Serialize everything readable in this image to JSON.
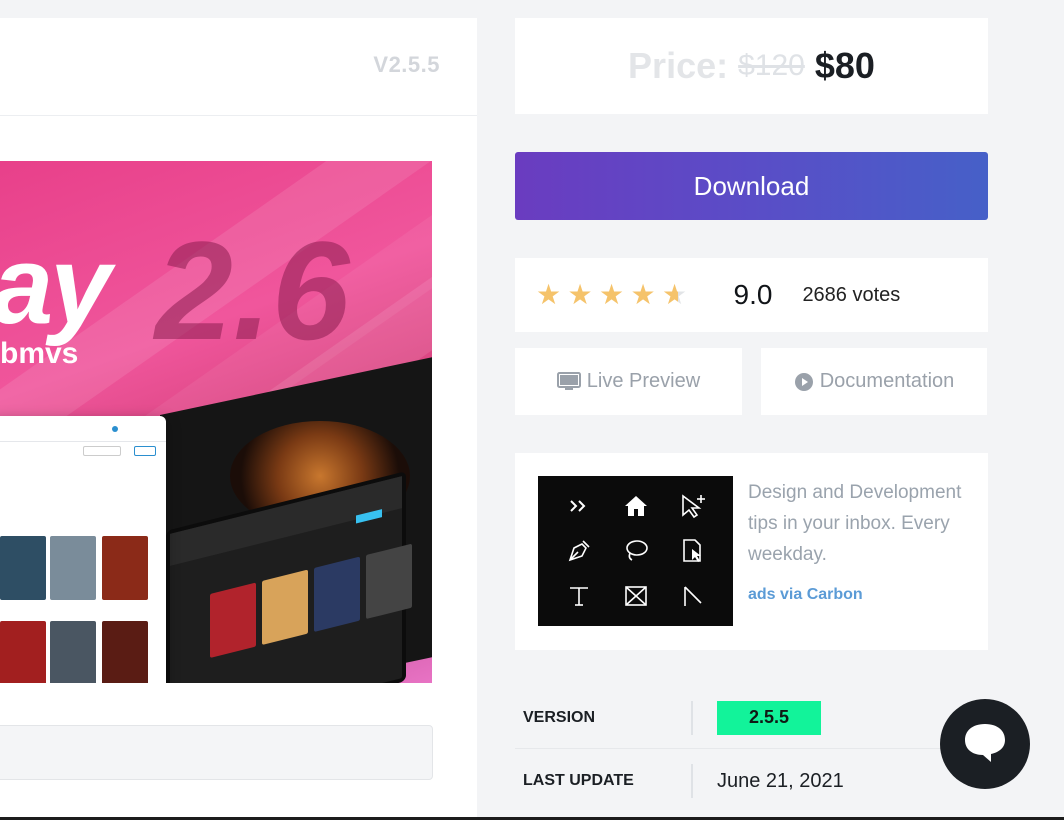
{
  "header": {
    "version_tag": "V2.5.5"
  },
  "hero": {
    "title": "ay",
    "version": "2.6",
    "subtitle": "bmvs"
  },
  "price": {
    "label": "Price:",
    "old": "$120",
    "new": "$80"
  },
  "download": {
    "label": "Download"
  },
  "rating": {
    "value_fraction": 0.9,
    "score": "9.0",
    "votes": "2686 votes"
  },
  "links": {
    "live_preview": "Live Preview",
    "documentation": "Documentation"
  },
  "ad": {
    "text": "Design and Development tips in your inbox. Every weekday.",
    "link": "ads via Carbon",
    "icons": [
      "double-chevron-icon",
      "home-icon",
      "cursor-plus-icon",
      "pen-tool-icon",
      "lasso-icon",
      "file-cursor-icon",
      "text-tool-icon",
      "frame-icon",
      "slice-icon"
    ]
  },
  "meta": {
    "version_label": "VERSION",
    "version_value": "2.5.5",
    "update_label": "LAST UPDATE",
    "update_value": "June 21, 2021"
  },
  "colors": {
    "accent_gradient_start": "#6a3cc0",
    "accent_gradient_end": "#4660c8",
    "star": "#f5c36b",
    "version_badge": "#12f39a",
    "link": "#5b9bd6"
  }
}
